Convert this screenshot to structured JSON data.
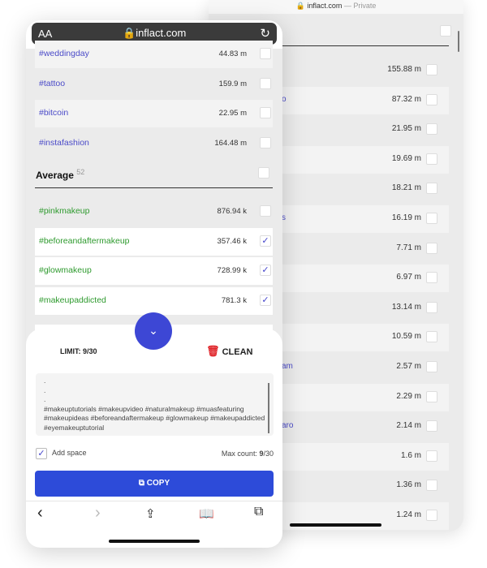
{
  "back_browser": {
    "url": "inflact.com",
    "private_label": "— Private",
    "rows": [
      {
        "fragment": "",
        "value": "155.88 m"
      },
      {
        "fragment": "o",
        "value": "87.32 m"
      },
      {
        "fragment": "",
        "value": "21.95 m"
      },
      {
        "fragment": "",
        "value": "19.69 m"
      },
      {
        "fragment": "",
        "value": "18.21 m"
      },
      {
        "fragment": "s",
        "value": "16.19 m"
      },
      {
        "fragment": "",
        "value": "7.71 m"
      },
      {
        "fragment": "",
        "value": "6.97 m"
      },
      {
        "fragment": "",
        "value": "13.14 m"
      },
      {
        "fragment": "",
        "value": "10.59 m"
      },
      {
        "fragment": "am",
        "value": "2.57 m"
      },
      {
        "fragment": "",
        "value": "2.29 m"
      },
      {
        "fragment": "aro",
        "value": "2.14 m"
      },
      {
        "fragment": "",
        "value": "1.6 m"
      },
      {
        "fragment": "",
        "value": "1.36 m"
      },
      {
        "fragment": "",
        "value": "1.24 m"
      }
    ]
  },
  "front_browser": {
    "text_size": "AA",
    "url": "inflact.com",
    "top_rows": [
      {
        "tag": "#weddingday",
        "value": "44.83 m"
      },
      {
        "tag": "#tattoo",
        "value": "159.9 m"
      },
      {
        "tag": "#bitcoin",
        "value": "22.95 m"
      },
      {
        "tag": "#instafashion",
        "value": "164.48 m"
      }
    ],
    "section": {
      "title": "Average",
      "count": "52"
    },
    "avg_rows": [
      {
        "tag": "#pinkmakeup",
        "value": "876.94 k",
        "checked": false
      },
      {
        "tag": "#beforeandaftermakeup",
        "value": "357.46 k",
        "checked": true
      },
      {
        "tag": "#glowmakeup",
        "value": "728.99 k",
        "checked": true
      },
      {
        "tag": "#makeupaddicted",
        "value": "781.3 k",
        "checked": true
      }
    ],
    "panel": {
      "limit": "LIMIT: 9/30",
      "clean": "CLEAN",
      "dots": [
        ".",
        ".",
        "."
      ],
      "text": "#makeuptutorials #makeupvideo #naturalmakeup #muasfeaturing #makeupideas #beforeandaftermakeup #glowmakeup #makeupaddicted #eyemakeuptutorial",
      "add_space": "Add space",
      "add_space_checked": true,
      "max_label": "Max count:",
      "max_current": "9",
      "max_total": "/30",
      "copy": "COPY"
    }
  },
  "colors": {
    "accent": "#3d47d5",
    "copy_button": "#2d4bd9",
    "tag_blue": "#4a4ac8",
    "tag_green": "#2e9a2e",
    "clean_red": "#e0262b"
  }
}
